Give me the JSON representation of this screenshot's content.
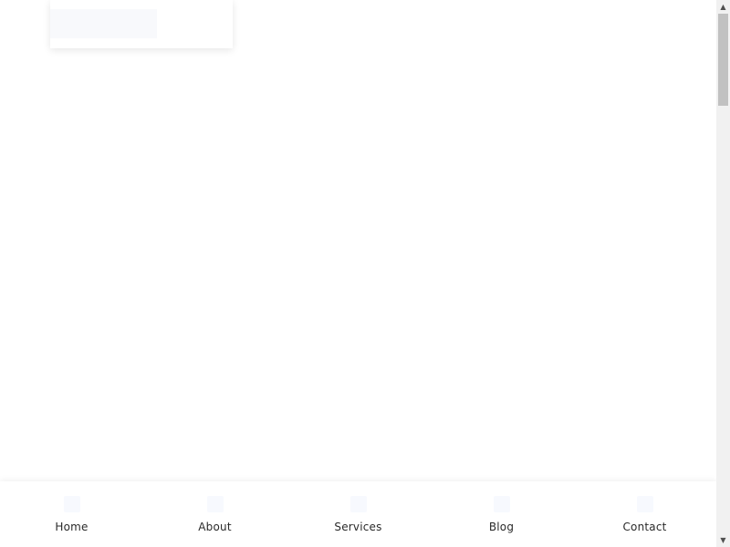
{
  "bottom_nav": {
    "items": [
      {
        "label": "Home",
        "icon": "home-icon"
      },
      {
        "label": "About",
        "icon": "about-icon"
      },
      {
        "label": "Services",
        "icon": "services-icon"
      },
      {
        "label": "Blog",
        "icon": "blog-icon"
      },
      {
        "label": "Contact",
        "icon": "contact-icon"
      }
    ]
  },
  "scrollbar": {
    "up_arrow": "▲",
    "down_arrow": "▼"
  }
}
